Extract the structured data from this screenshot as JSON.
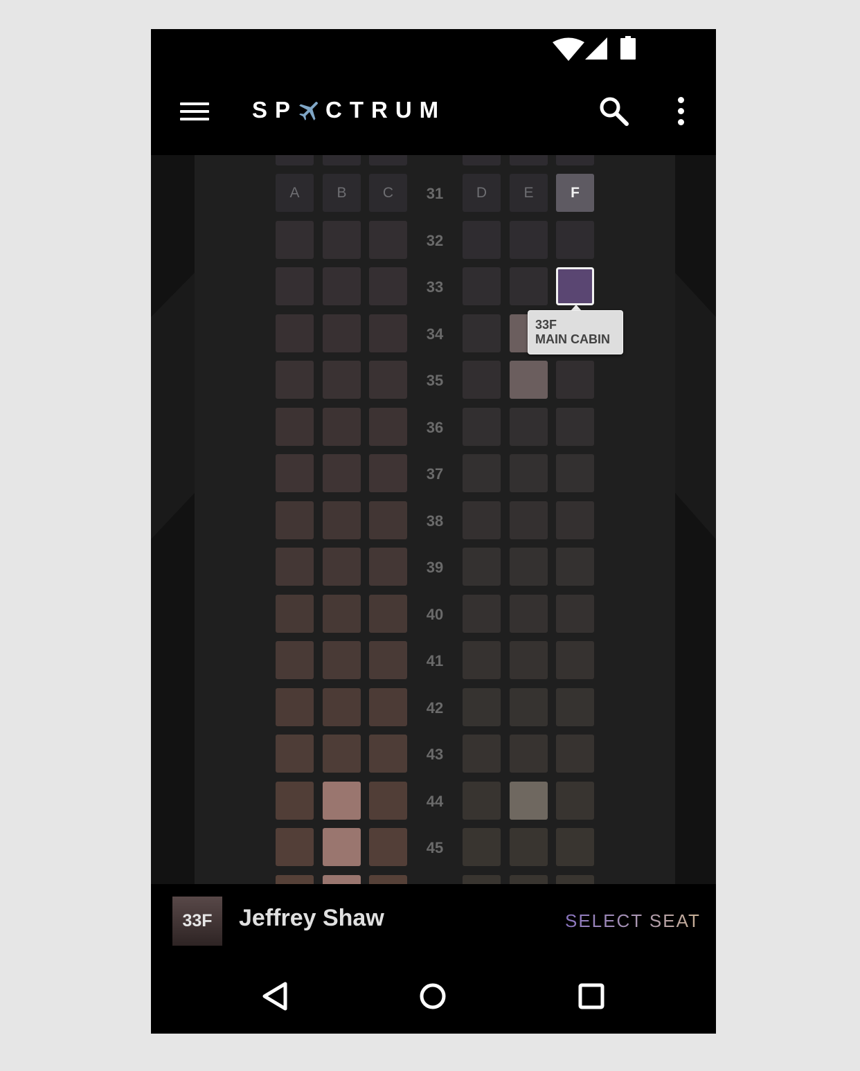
{
  "app": {
    "brand": {
      "left": "SP",
      "right": "CTRUM"
    },
    "brand_color": "#ffffff",
    "background": "#000000"
  },
  "status_bar": {
    "icons": [
      "wifi-icon",
      "signal-icon",
      "battery-icon"
    ]
  },
  "app_bar": {
    "icons": [
      "menu-icon",
      "plane-icon",
      "search-icon",
      "more-vert-icon"
    ]
  },
  "seat_map": {
    "column_letters": [
      "A",
      "B",
      "C",
      "D",
      "E",
      "F"
    ],
    "rows": [
      "31",
      "32",
      "33",
      "34",
      "35",
      "36",
      "37",
      "38",
      "39",
      "40",
      "41",
      "42",
      "43",
      "44",
      "45"
    ],
    "highlighted_header": "F",
    "selected_seat": "33F",
    "highlighted_seats": [
      "34E",
      "35E",
      "44B",
      "44E",
      "45B",
      "46B"
    ],
    "tooltip": {
      "seat": "33F",
      "cabin": "MAIN CABIN"
    },
    "colors": {
      "selected_seat": "#5a4672",
      "selected_border": "#f2f2f2",
      "left_top": "#2e2b30",
      "left_bottom": "#584239",
      "right_top": "#2e2b30",
      "right_bottom": "#3a3630",
      "highlight_left": "#9a766f",
      "highlight_right": "#6f6860",
      "highlight_mid": "#6b5e5e"
    }
  },
  "bottom_bar": {
    "seat_badge": "33F",
    "passenger_name": "Jeffrey Shaw",
    "select_label": "SELECT SEAT",
    "accent_colors": [
      "#8a74c0",
      "#c8b094"
    ]
  },
  "nav_bar": {
    "icons": [
      "back-icon",
      "home-icon",
      "recents-icon"
    ]
  }
}
